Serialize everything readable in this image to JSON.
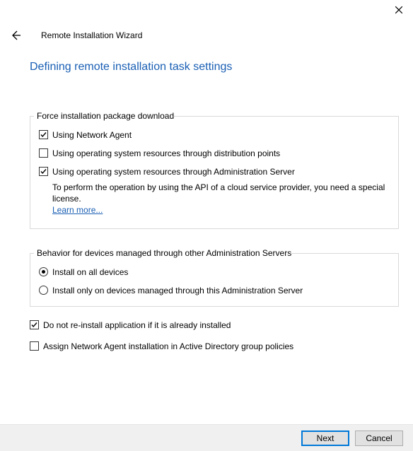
{
  "header": {
    "wizard_title": "Remote Installation Wizard",
    "page_title": "Defining remote installation task settings"
  },
  "group_force": {
    "legend": "Force installation package download",
    "options": [
      {
        "label": "Using Network Agent",
        "checked": true
      },
      {
        "label": "Using operating system resources through distribution points",
        "checked": false
      },
      {
        "label": "Using operating system resources through Administration Server",
        "checked": true
      }
    ],
    "hint": "To perform the operation by using the API of a cloud service provider, you need a special license.",
    "learn_more": "Learn more..."
  },
  "group_behavior": {
    "legend": "Behavior for devices managed through other Administration Servers",
    "options": [
      {
        "label": "Install on all devices",
        "selected": true
      },
      {
        "label": "Install only on devices managed through this Administration Server",
        "selected": false
      }
    ]
  },
  "standalone": [
    {
      "label": "Do not re-install application if it is already installed",
      "checked": true
    },
    {
      "label": "Assign Network Agent installation in Active Directory group policies",
      "checked": false
    }
  ],
  "footer": {
    "next": "Next",
    "cancel": "Cancel"
  }
}
